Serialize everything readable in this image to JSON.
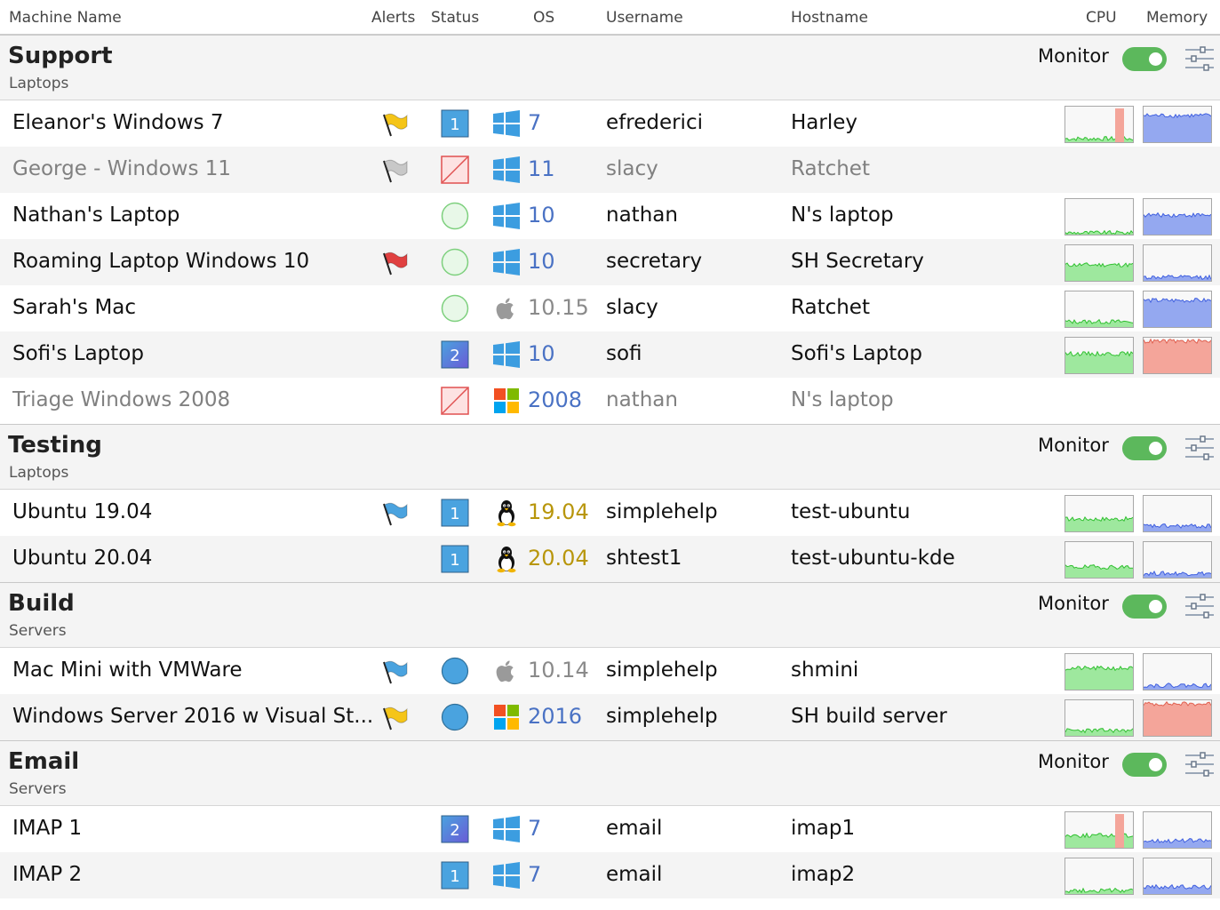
{
  "header": {
    "machine_name": "Machine Name",
    "alerts": "Alerts",
    "status": "Status",
    "os": "OS",
    "username": "Username",
    "hostname": "Hostname",
    "cpu": "CPU",
    "memory": "Memory"
  },
  "groups": [
    {
      "title": "Support",
      "subtitle": "Laptops",
      "monitor_label": "Monitor",
      "monitor_on": true,
      "rows": [
        {
          "name": "Eleanor's Windows 7",
          "flag": "yellow",
          "status": "1",
          "os_icon": "windows-blue",
          "os": "7",
          "user": "efrederici",
          "host": "Harley",
          "online": true,
          "cpu_level": 0.1,
          "mem_level": 0.75,
          "mem_color": "blue",
          "cpu_spike": "red"
        },
        {
          "name": "George - Windows 11",
          "flag": "gray",
          "status": "offline",
          "os_icon": "windows-blue",
          "os": "11",
          "user": "slacy",
          "host": "Ratchet",
          "online": false
        },
        {
          "name": "Nathan's Laptop",
          "flag": "",
          "status": "idle",
          "os_icon": "windows-blue",
          "os": "10",
          "user": "nathan",
          "host": "N's laptop",
          "online": true,
          "cpu_level": 0.05,
          "mem_level": 0.55,
          "mem_color": "blue"
        },
        {
          "name": "Roaming Laptop Windows 10",
          "flag": "red",
          "status": "idle",
          "os_icon": "windows-blue",
          "os": "10",
          "user": "secretary",
          "host": "SH Secretary",
          "online": true,
          "cpu_level": 0.45,
          "mem_level": 0.1,
          "mem_color": "blue"
        },
        {
          "name": "Sarah's Mac",
          "flag": "",
          "status": "idle",
          "os_icon": "apple",
          "os": "10.15",
          "user": "slacy",
          "host": "Ratchet",
          "online": true,
          "cpu_level": 0.15,
          "mem_level": 0.75,
          "mem_color": "blue"
        },
        {
          "name": "Sofi's Laptop",
          "flag": "",
          "status": "2",
          "os_icon": "windows-blue",
          "os": "10",
          "user": "sofi",
          "host": "Sofi's Laptop",
          "online": true,
          "cpu_level": 0.55,
          "mem_level": 0.9,
          "mem_color": "red"
        },
        {
          "name": "Triage Windows 2008",
          "flag": "",
          "status": "offline",
          "os_icon": "windows-color",
          "os": "2008",
          "user": "nathan",
          "host": "N's laptop",
          "online": false
        }
      ]
    },
    {
      "title": "Testing",
      "subtitle": "Laptops",
      "monitor_label": "Monitor",
      "monitor_on": true,
      "rows": [
        {
          "name": "Ubuntu 19.04",
          "flag": "blue",
          "status": "1",
          "os_icon": "linux",
          "os": "19.04",
          "user": "simplehelp",
          "host": "test-ubuntu",
          "online": true,
          "cpu_level": 0.35,
          "mem_level": 0.15,
          "mem_color": "blue"
        },
        {
          "name": "Ubuntu 20.04",
          "flag": "",
          "status": "1",
          "os_icon": "linux",
          "os": "20.04",
          "user": "shtest1",
          "host": "test-ubuntu-kde",
          "online": true,
          "cpu_level": 0.3,
          "mem_level": 0.12,
          "mem_color": "blue"
        }
      ]
    },
    {
      "title": "Build",
      "subtitle": "Servers",
      "monitor_label": "Monitor",
      "monitor_on": true,
      "rows": [
        {
          "name": "Mac Mini with VMWare",
          "flag": "blue",
          "status": "active",
          "os_icon": "apple",
          "os": "10.14",
          "user": "simplehelp",
          "host": "shmini",
          "online": true,
          "cpu_level": 0.6,
          "mem_level": 0.12,
          "mem_color": "blue"
        },
        {
          "name": "Windows Server 2016 w Visual St...",
          "flag": "yellow",
          "status": "active",
          "os_icon": "windows-color",
          "os": "2016",
          "user": "simplehelp",
          "host": "SH build server",
          "online": true,
          "cpu_level": 0.15,
          "mem_level": 0.9,
          "mem_color": "red"
        }
      ]
    },
    {
      "title": "Email",
      "subtitle": "Servers",
      "monitor_label": "Monitor",
      "monitor_on": true,
      "rows": [
        {
          "name": "IMAP 1",
          "flag": "",
          "status": "2",
          "os_icon": "windows-blue",
          "os": "7",
          "user": "email",
          "host": "imap1",
          "online": true,
          "cpu_level": 0.35,
          "mem_level": 0.2,
          "mem_color": "blue",
          "cpu_spike": "red"
        },
        {
          "name": "IMAP 2",
          "flag": "",
          "status": "1",
          "os_icon": "windows-blue",
          "os": "7",
          "user": "email",
          "host": "imap2",
          "online": true,
          "cpu_level": 0.1,
          "mem_level": 0.2,
          "mem_color": "blue"
        }
      ]
    }
  ],
  "colors": {
    "flag_yellow": "#f5c518",
    "flag_gray": "#c8c8c8",
    "flag_red": "#e04040",
    "flag_blue": "#4aa3df",
    "status_badge_blue": "#4aa3df",
    "status_badge_purple": "#6a5ad6",
    "status_idle_green": "#7ed07e",
    "status_active_blue": "#4aa3df",
    "offline_red": "#e05050",
    "cpu_green": "#9ee89e",
    "mem_blue": "#94a8f0",
    "mem_red": "#f4a59a",
    "toggle_green": "#5cb85c"
  }
}
